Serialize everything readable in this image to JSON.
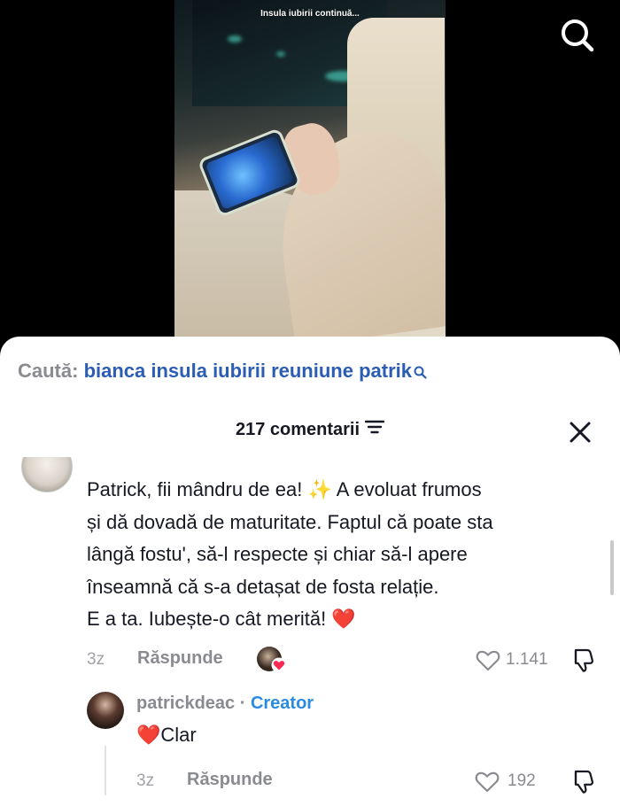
{
  "video": {
    "caption": "Insula iubirii continuă..."
  },
  "search_suggestion": {
    "prefix": "Caută:",
    "term": "bianca insula iubirii reuniune patrik"
  },
  "comments_panel": {
    "count_label": "217 comentarii",
    "comment": {
      "lines": [
        "Patrick, fii mândru de ea! ",
        "și dă dovadă de maturitate. Faptul că poate sta",
        "lângă fostu', să-l respecte și chiar să-l apere",
        "înseamnă că s-a detașat de fosta relație.",
        "E a ta. Iubește-o cât merită! "
      ],
      "line1_after_sparkle": " A evoluat frumos",
      "sparkle_emoji": "✨",
      "heart_emoji": "❤️",
      "time": "3z",
      "reply_label": "Răspunde",
      "likes": "1.141"
    },
    "reply": {
      "username": "patrickdeac",
      "separator": " · ",
      "badge": "Creator",
      "heart_emoji": "❤️",
      "text": "Clar",
      "time": "3z",
      "reply_label": "Răspunde",
      "likes": "192"
    }
  },
  "colors": {
    "accent_blue": "#2b5db5",
    "creator_blue": "#2b8be0",
    "heart_red": "#e0242b"
  }
}
